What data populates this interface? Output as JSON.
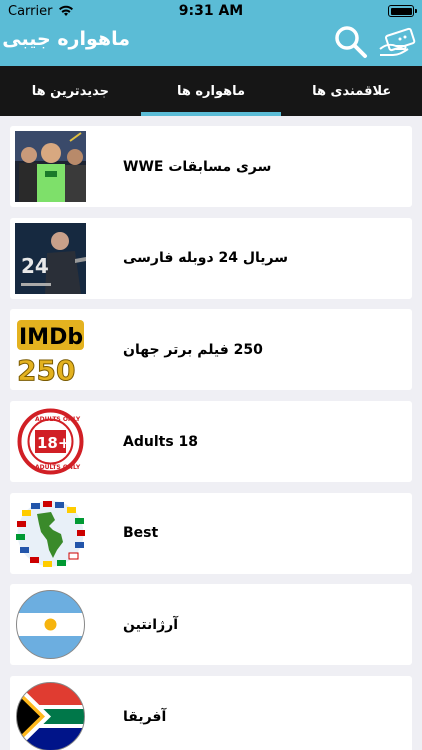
{
  "status": {
    "carrier": "Carrier",
    "time": "9:31 AM"
  },
  "nav": {
    "title": "ماهواره جیبی",
    "icons": [
      "search-icon",
      "remote-icon"
    ]
  },
  "tabs": [
    {
      "label": "علاقمندی ها",
      "active": false
    },
    {
      "label": "ماهواره ها",
      "active": true
    },
    {
      "label": "جدیدترین ها",
      "active": false
    }
  ],
  "items": [
    {
      "label": "سری مسابقات WWE",
      "icon": "wwe-thumbnail"
    },
    {
      "label": "سریال 24 دوبله فارسی",
      "icon": "24-series-thumbnail"
    },
    {
      "label": "250 فیلم برتر جهان",
      "icon": "imdb-250-thumbnail"
    },
    {
      "label": "Adults  18",
      "icon": "18-plus-badge"
    },
    {
      "label": "Best",
      "icon": "americas-flags-globe"
    },
    {
      "label": "آرژانتین",
      "icon": "argentina-flag"
    },
    {
      "label": "آفریقا",
      "icon": "south-africa-flag"
    }
  ],
  "colors": {
    "accent": "#5bbcd6",
    "tabbar": "#161616",
    "background": "#efeff4"
  }
}
